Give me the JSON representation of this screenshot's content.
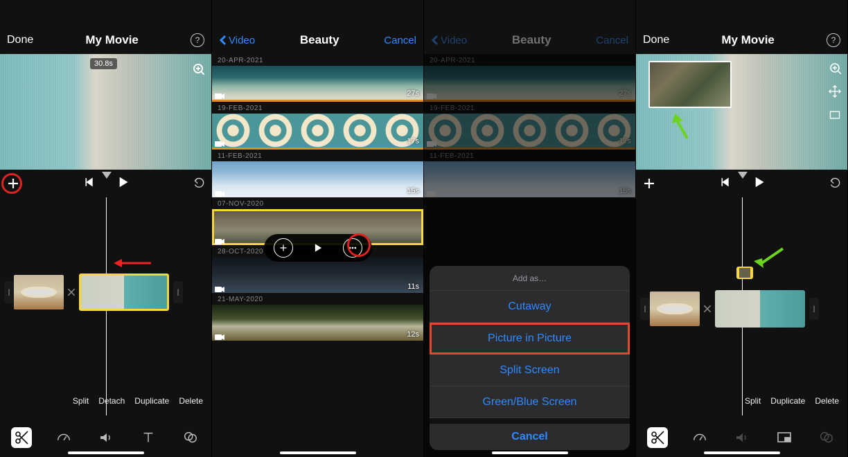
{
  "panel1": {
    "done": "Done",
    "title": "My Movie",
    "time_pill": "30.8s",
    "actions": [
      "Split",
      "Detach",
      "Duplicate",
      "Delete"
    ]
  },
  "panel2": {
    "back": "Video",
    "title": "Beauty",
    "cancel": "Cancel",
    "groups": [
      {
        "date": "20-APR-2021",
        "duration": "27s",
        "orange": true,
        "style": "sf-wave",
        "selected": false
      },
      {
        "date": "19-FEB-2021",
        "duration": "17s",
        "orange": true,
        "style": "sf-circles",
        "selected": false
      },
      {
        "date": "11-FEB-2021",
        "duration": "15s",
        "orange": false,
        "style": "sf-cloud",
        "selected": false
      },
      {
        "date": "07-NOV-2020",
        "duration": "",
        "orange": false,
        "style": "sf-city",
        "selected": true
      },
      {
        "date": "28-OCT-2020",
        "duration": "11s",
        "orange": false,
        "style": "sf-dark",
        "selected": false
      },
      {
        "date": "21-MAY-2020",
        "duration": "12s",
        "orange": false,
        "style": "sf-legs",
        "selected": false
      }
    ]
  },
  "panel3": {
    "back": "Video",
    "title": "Beauty",
    "cancel": "Cancel",
    "groups": [
      {
        "date": "20-APR-2021",
        "duration": "27s",
        "orange": true,
        "style": "sf-wave"
      },
      {
        "date": "19-FEB-2021",
        "duration": "17s",
        "orange": true,
        "style": "sf-circles"
      },
      {
        "date": "11-FEB-2021",
        "duration": "15s",
        "orange": false,
        "style": "sf-cloud"
      }
    ],
    "sheet": {
      "title": "Add as…",
      "options": [
        "Cutaway",
        "Picture in Picture",
        "Split Screen",
        "Green/Blue Screen"
      ],
      "highlight_index": 1,
      "cancel": "Cancel"
    }
  },
  "panel4": {
    "done": "Done",
    "title": "My Movie",
    "actions": [
      "Split",
      "Duplicate",
      "Delete"
    ]
  }
}
